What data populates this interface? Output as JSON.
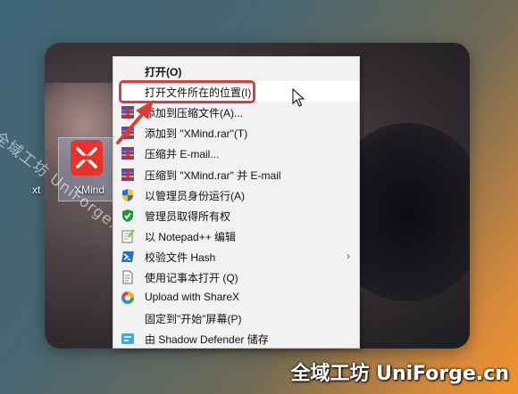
{
  "desktop": {
    "file_left_label": "xt",
    "file_label": "XMind",
    "watermark": "全域工坊 UniForge.cn"
  },
  "context_menu": {
    "items": [
      {
        "label": "打开(O)",
        "icon": "none",
        "bold": true
      },
      {
        "label": "打开文件所在的位置(I)",
        "icon": "none",
        "hovered": true
      },
      {
        "label": "添加到压缩文件(A)...",
        "icon": "winrar-icon"
      },
      {
        "label": "添加到 \"XMind.rar\"(T)",
        "icon": "winrar-icon"
      },
      {
        "label": "压缩并 E-mail...",
        "icon": "winrar-icon"
      },
      {
        "label": "压缩到 \"XMind.rar\" 并 E-mail",
        "icon": "winrar-icon"
      },
      {
        "label": "以管理员身份运行(A)",
        "icon": "uac-shield-icon"
      },
      {
        "label": "管理员取得所有权",
        "icon": "green-shield-check-icon"
      },
      {
        "label": "以 Notepad++ 编辑",
        "icon": "notepad-plus-plus-icon"
      },
      {
        "label": "校验文件 Hash",
        "icon": "powershell-icon",
        "submenu": true
      },
      {
        "label": "使用记事本打开 (Q)",
        "icon": "document-icon"
      },
      {
        "label": "Upload with ShareX",
        "icon": "sharex-icon"
      },
      {
        "label": "固定到\"开始\"屏幕(P)",
        "icon": "none"
      },
      {
        "label": "由 Shadow Defender 储存",
        "icon": "shadow-defender-icon"
      }
    ]
  },
  "brand": "全域工坊 UniForge.cn",
  "colors": {
    "highlight": "#d7403a",
    "xmind_red": "#e8332d",
    "menu_bg": "#f2f2f2"
  }
}
